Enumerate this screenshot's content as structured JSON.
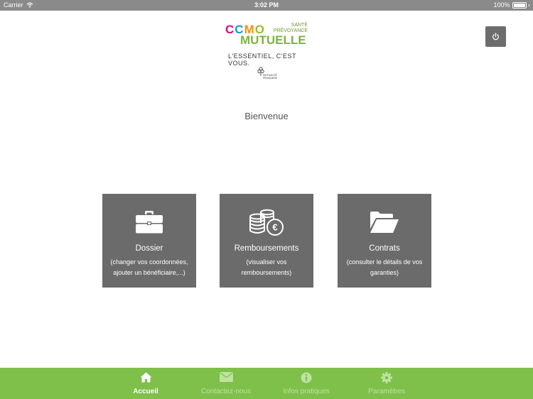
{
  "status_bar": {
    "carrier": "Carrier",
    "time": "3:02 PM",
    "battery": "100%",
    "battery_level": 1.0
  },
  "logo": {
    "brand_top": "CCMO",
    "brand_sub_1": "SANTÉ",
    "brand_sub_2": "PRÉVOYANCE",
    "brand_main": "MUTUELLE",
    "tagline": "L'ESSENTIEL, C'EST VOUS.",
    "partner_line_1": "MUTUALITÉ",
    "partner_line_2": "FRANÇAISE"
  },
  "header": {
    "power_icon": "power-icon"
  },
  "welcome": "Bienvenue",
  "tiles": [
    {
      "icon": "briefcase-icon",
      "title": "Dossier",
      "description": "(changer vos coordonnées, ajouter un bénéficiaire,...)"
    },
    {
      "icon": "coins-euro-icon",
      "title": "Remboursements",
      "description": "(visualiser vos remboursements)"
    },
    {
      "icon": "folder-open-icon",
      "title": "Contrats",
      "description": "(consulter le détails de vos garanties)"
    }
  ],
  "tabs": [
    {
      "icon": "home-icon",
      "label": "Accueil",
      "active": true
    },
    {
      "icon": "envelope-icon",
      "label": "Contactez-nous",
      "active": false
    },
    {
      "icon": "info-icon",
      "label": "Infos pratiques",
      "active": false
    },
    {
      "icon": "gear-icon",
      "label": "Paramètres",
      "active": false
    }
  ],
  "colors": {
    "status_bar": "#8a8a8a",
    "tile": "#6b6b6b",
    "tab_bar": "#7ec04a",
    "tab_inactive": "#bfe3a0",
    "brand_green": "#7ab53b"
  }
}
